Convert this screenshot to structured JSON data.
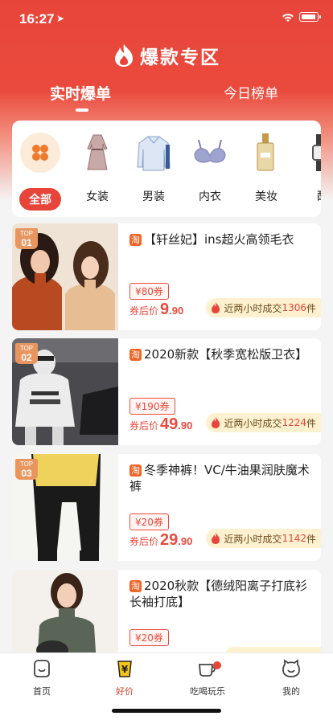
{
  "status": {
    "time": "16:27"
  },
  "header": {
    "title": "爆款专区"
  },
  "tabs": {
    "active": "实时爆单",
    "other": "今日榜单"
  },
  "categories": [
    {
      "label": "全部",
      "icon": "grid-icon"
    },
    {
      "label": "女装",
      "icon": "dress-icon"
    },
    {
      "label": "男装",
      "icon": "shirt-icon"
    },
    {
      "label": "内衣",
      "icon": "bra-icon"
    },
    {
      "label": "美妆",
      "icon": "perfume-icon"
    },
    {
      "label": "配",
      "icon": "watch-icon"
    }
  ],
  "products": [
    {
      "rank": "01",
      "rank_label": "TOP",
      "tao": "淘",
      "title": "【轩丝妃】ins超火高领毛衣",
      "coupon": "¥80券",
      "price_label": "券后价",
      "price_int": "9",
      "price_dec": ".90",
      "sales_prefix": "近两小时成交",
      "sales_count": "1306",
      "sales_unit": "件"
    },
    {
      "rank": "02",
      "rank_label": "TOP",
      "tao": "淘",
      "title": "2020新款【秋季宽松版卫衣】",
      "coupon": "¥190券",
      "price_label": "券后价",
      "price_int": "49",
      "price_dec": ".90",
      "sales_prefix": "近两小时成交",
      "sales_count": "1224",
      "sales_unit": "件"
    },
    {
      "rank": "03",
      "rank_label": "TOP",
      "tao": "淘",
      "title": "冬季神裤！VC/牛油果润肤魔术裤",
      "coupon": "¥20券",
      "price_label": "券后价",
      "price_int": "29",
      "price_dec": ".90",
      "sales_prefix": "近两小时成交",
      "sales_count": "1142",
      "sales_unit": "件"
    },
    {
      "rank": "",
      "rank_label": "",
      "tao": "淘",
      "title": "2020秋款【德绒阳离子打底衫长袖打底】",
      "coupon": "¥20券",
      "price_label": "",
      "price_int": "",
      "price_dec": "",
      "sales_prefix": "",
      "sales_count": "",
      "sales_unit": ""
    }
  ],
  "tabbar": [
    {
      "label": "首页",
      "icon": "home-icon"
    },
    {
      "label": "好价",
      "icon": "yen-bag-icon",
      "active": true
    },
    {
      "label": "吃喝玩乐",
      "icon": "cup-icon",
      "dot": true
    },
    {
      "label": "我的",
      "icon": "bear-face-icon"
    }
  ],
  "colors": {
    "brand_red": "#e8453a",
    "tao_orange": "#f0662a",
    "sales_bg": "#fdf1cf"
  }
}
